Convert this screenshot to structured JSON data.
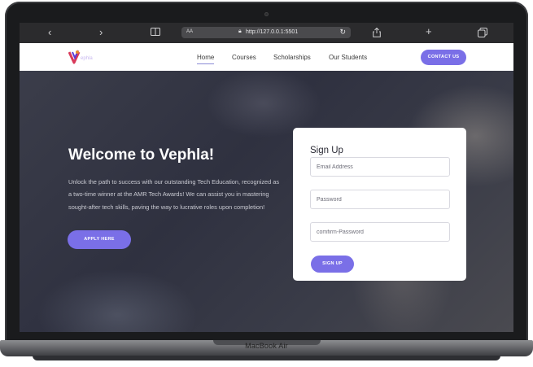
{
  "device": {
    "model_label": "MacBook Air"
  },
  "browser": {
    "text_size_label": "AA",
    "url": "http://127.0.0.1:5501",
    "icons": [
      "chevron-left-icon",
      "chevron-right-icon",
      "book-icon",
      "lock-icon",
      "reload-icon",
      "share-icon",
      "plus-icon",
      "tabs-icon"
    ]
  },
  "nav": {
    "links": [
      {
        "label": "Home",
        "active": true
      },
      {
        "label": "Courses",
        "active": false
      },
      {
        "label": "Scholarships",
        "active": false
      },
      {
        "label": "Our Students",
        "active": false
      }
    ],
    "contact_label": "CONTACT US"
  },
  "hero": {
    "title": "Welcome to Vephla!",
    "text": "Unlock the path to success with our outstanding Tech Education, recognized as a two-time winner at the AMR Tech Awards! We can assist you in mastering sought-after tech skills, paving the way to lucrative roles upon completion!",
    "apply_label": "APPLY HERE"
  },
  "signup": {
    "title": "Sign Up",
    "email_placeholder": "Email Address",
    "password_placeholder": "Password",
    "confirm_placeholder": "comfirm-Password",
    "button_label": "SIGN UP"
  },
  "colors": {
    "accent": "#7a6fe7",
    "logo_red": "#d93a5a",
    "logo_purple": "#5b3bd6"
  }
}
